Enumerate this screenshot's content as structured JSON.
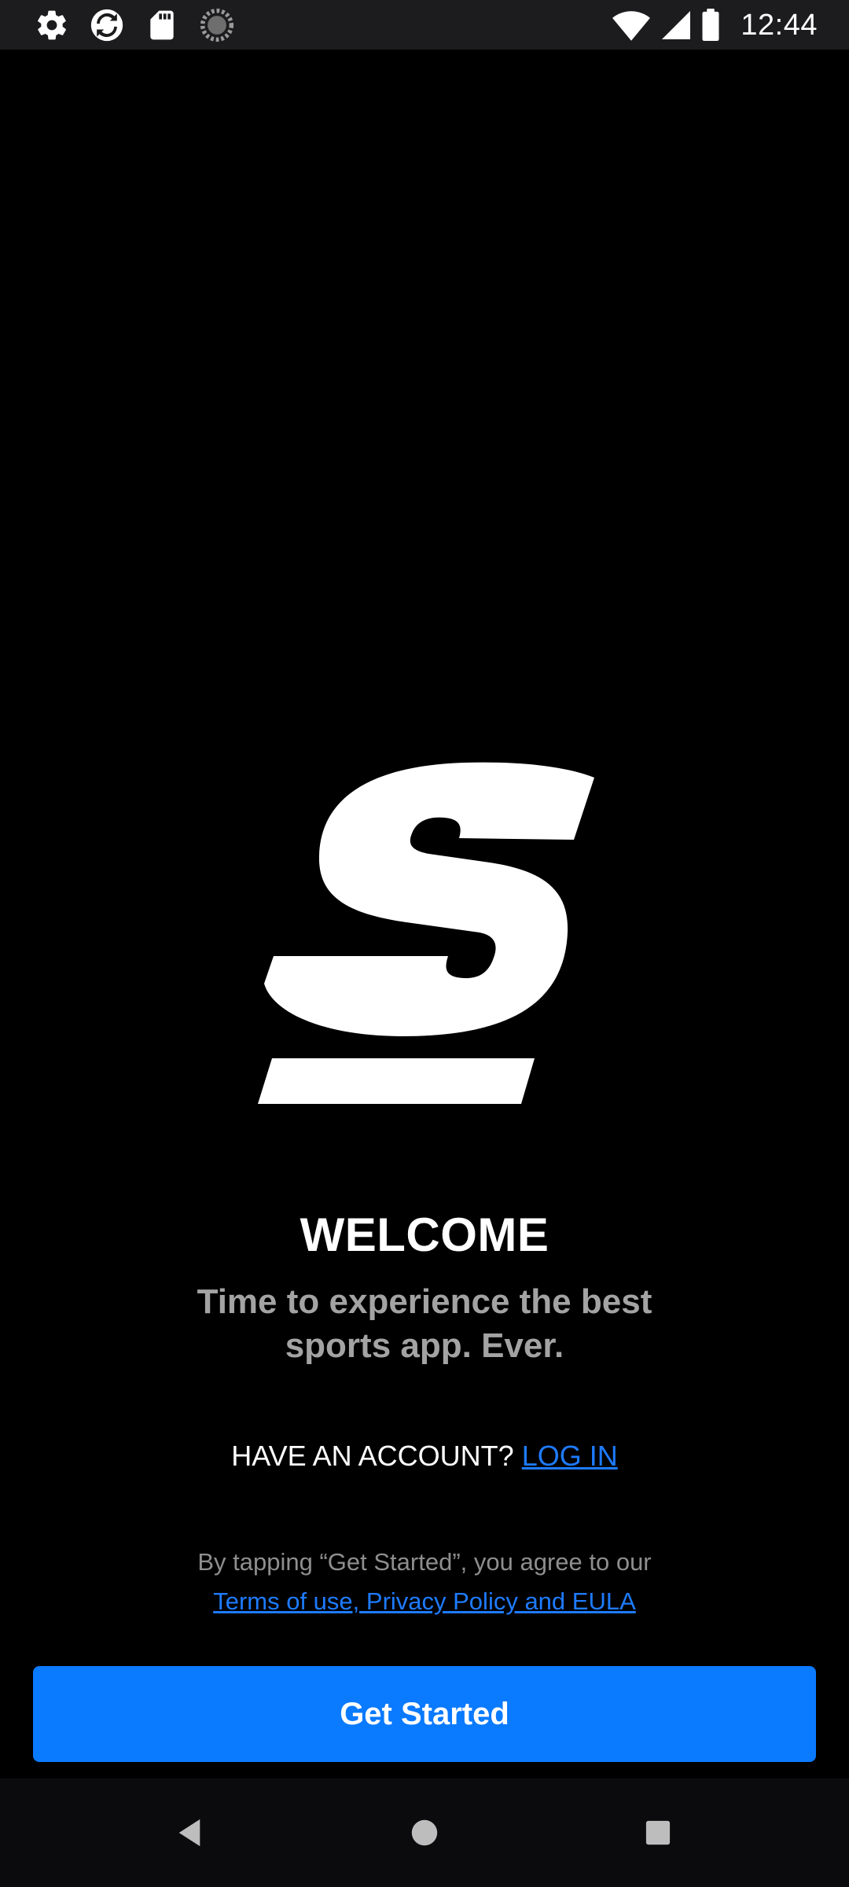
{
  "status_bar": {
    "time": "12:44",
    "left_icons": [
      "settings-gear-icon",
      "sync-refresh-icon",
      "sd-card-icon",
      "loading-spinner-icon"
    ],
    "right_icons": [
      "wifi-icon",
      "cellular-signal-icon",
      "battery-icon"
    ]
  },
  "logo": {
    "name": "app-logo-s",
    "color": "#ffffff"
  },
  "welcome": {
    "title": "WELCOME",
    "subtitle": "Time to experience the best sports app. Ever."
  },
  "account": {
    "prompt": "HAVE AN ACCOUNT?",
    "login_label": "LOG IN"
  },
  "legal": {
    "text": "By tapping “Get Started”, you agree to our",
    "link_label": "Terms of use, Privacy Policy and EULA"
  },
  "cta": {
    "label": "Get Started"
  },
  "nav_bar": {
    "icons": [
      "back-icon",
      "home-icon",
      "recents-icon"
    ]
  },
  "colors": {
    "background": "#000000",
    "accent": "#0a7aff",
    "link": "#1e7bff",
    "subtitle": "#a3a3a3",
    "legal_text": "#8e8e8e"
  }
}
